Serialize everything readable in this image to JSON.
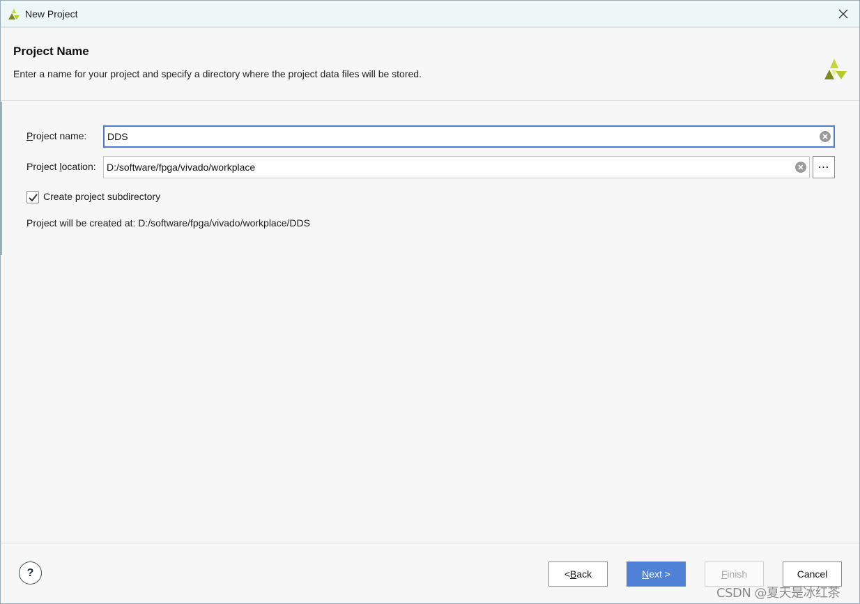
{
  "window": {
    "title": "New Project"
  },
  "header": {
    "title": "Project Name",
    "description": "Enter a name for your project and specify a directory where the project data files will be stored."
  },
  "form": {
    "project_name_label_pre": "P",
    "project_name_label_post": "roject name:",
    "project_name_value": "DDS",
    "project_location_label_pre": "Project ",
    "project_location_label_u": "l",
    "project_location_label_post": "ocation:",
    "project_location_value": "D:/software/fpga/vivado/workplace",
    "browse_label": "⋯",
    "subdirectory_label": "Create project subdirectory",
    "subdirectory_checked": true,
    "created_at_text": "Project will be created at: D:/software/fpga/vivado/workplace/DDS"
  },
  "footer": {
    "help_label": "?",
    "back_pre": "< ",
    "back_u": "B",
    "back_post": "ack",
    "next_u": "N",
    "next_post": "ext >",
    "finish_u": "F",
    "finish_post": "inish",
    "cancel_label": "Cancel"
  },
  "watermark": "CSDN @夏天是冰红茶",
  "colors": {
    "accent": "#4f82d6",
    "focus_border": "#4b7bd1",
    "logo_green": "#b5c928",
    "logo_dark": "#7d8a1c"
  },
  "icons": {
    "app_logo": "vivado-logo-icon",
    "close": "close-icon",
    "clear": "clear-icon",
    "check": "checkmark-icon"
  }
}
